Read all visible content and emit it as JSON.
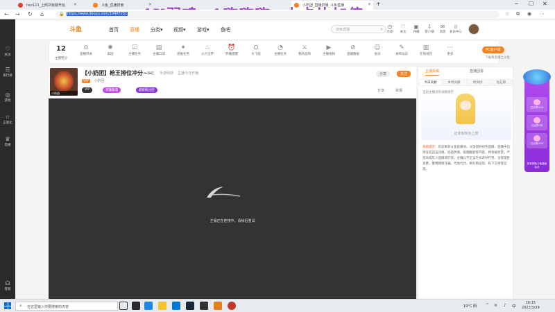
{
  "overlay_text": "1X弱鸡=1嗨嗨嗨~小卡片加倍",
  "browser": {
    "tabs": [
      {
        "label": "hez123_上网冲浪暴开始"
      },
      {
        "label": "斗鱼_直播搜索"
      },
      {
        "label": "小奶团_直播直播_斗鱼直播"
      }
    ],
    "url": "https://www.douyu.com/10407251"
  },
  "sidebar": {
    "items": [
      {
        "label": "关注",
        "icon": "heart-icon"
      },
      {
        "label": "排行榜",
        "icon": "list-icon"
      },
      {
        "label": "游戏",
        "icon": "gamepad-icon"
      },
      {
        "label": "正版化",
        "icon": "star-icon"
      },
      {
        "label": "直播",
        "icon": "cup-icon"
      },
      {
        "label": "客服",
        "icon": "headset-icon"
      }
    ]
  },
  "site_nav": {
    "logo": "斗鱼",
    "items": [
      "首页",
      "直播",
      "分类▾",
      "视频▾",
      "游戏▾",
      "鱼吧"
    ],
    "search_placeholder": "搜索直播",
    "icons": [
      "历史",
      "关注",
      "开播",
      "客户端",
      "消息",
      "会员中心"
    ]
  },
  "toolbar": {
    "level": "12",
    "level_label": "主播积分",
    "tools": [
      "直播开关",
      "美团",
      "主播任务",
      "主播口袋",
      "星推任务",
      "火力全开",
      "开播提醒",
      "大飞船",
      "主播任务",
      "我的战场",
      "主播视频",
      "直播数据",
      "会员",
      "发布动态",
      "在线语音",
      "更多"
    ],
    "pc_button": "PC客户端",
    "pc_sub": "下载看直播上斗鱼"
  },
  "stream": {
    "title": "【小奶团】枪王排位冲分~~",
    "category": "穿越",
    "tag": "手游网游",
    "live_status": "主播今日开播",
    "anchor_name": "小奶团",
    "level_badge": "VIP",
    "badges": [
      "英雄联盟",
      "超级粉丝团"
    ],
    "share": "分享",
    "follow": "关注",
    "actions": [
      "分享",
      "举报"
    ],
    "offline_msg": "主播正在连接中，请稍后重试"
  },
  "right_panel": {
    "tabs": [
      "主播投稿",
      "直播回看"
    ],
    "rank_tabs": [
      "今日贡献",
      "本周贡献",
      "周贡榜",
      "钻石榜"
    ],
    "rank_hint": "当前主播没有贡献排行",
    "empty_text": "还未有粉丝上榜",
    "notice_label": "系统提示：",
    "notice": "欢迎来到斗鱼直播间。斗鱼倡导绿色直播，直播中出现任何违法违规、低俗色情、吸烟酗酒等内容，将会被封禁。严禁未成年人直播或打赏，主播以不正当方式诱导打赏、注意理性消费，警惕网络诈骗，代他代付、刷礼物返现、私下交易等信息。"
  },
  "promo": {
    "items": [
      "已点赞0/10",
      "已点赞0/8",
      "已点赞0/15"
    ],
    "footer": "快来领取斗鱼超级会员"
  },
  "taskbar": {
    "search_placeholder": "在这里输入你要搜索的内容",
    "temp": "19°C 阴",
    "time": "18:15",
    "date": "2022/3/29"
  }
}
